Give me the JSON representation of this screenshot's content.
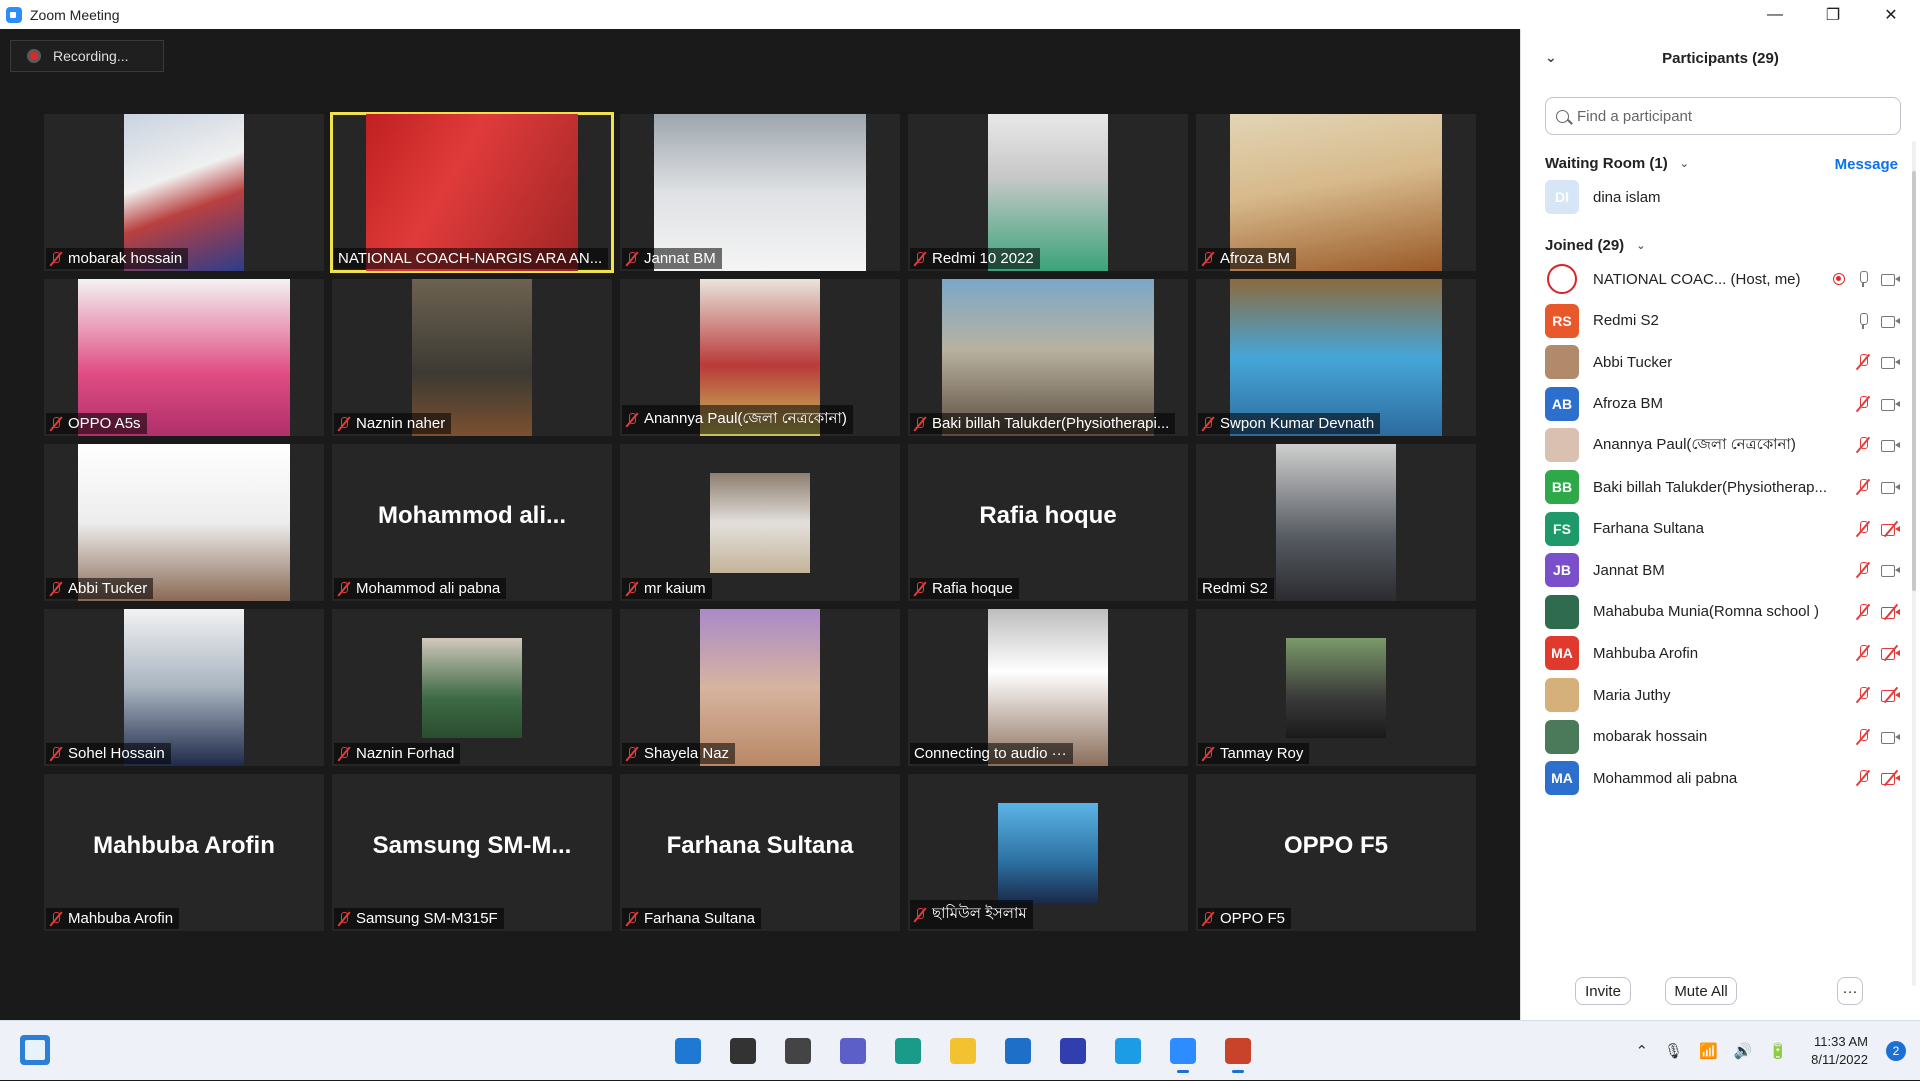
{
  "window": {
    "title": "Zoom Meeting",
    "minimize": "—",
    "restore": "❐",
    "close": "✕"
  },
  "recording": {
    "label": "Recording..."
  },
  "tiles": [
    {
      "label": "mobarak hossain",
      "muted": true,
      "video": "w-narrow",
      "bg": "bg1"
    },
    {
      "label": "NATIONAL COACH-NARGIS ARA AN...",
      "muted": false,
      "video": "w-wide",
      "bg": "bg2",
      "active": true
    },
    {
      "label": "Jannat BM",
      "muted": true,
      "video": "w-wide",
      "bg": "bg3"
    },
    {
      "label": "Redmi 10 2022",
      "muted": true,
      "video": "w-narrow",
      "bg": "bg4"
    },
    {
      "label": "Afroza BM",
      "muted": true,
      "video": "w-wide",
      "bg": "bg5"
    },
    {
      "label": "OPPO A5s",
      "muted": true,
      "video": "w-wide",
      "bg": "bg6"
    },
    {
      "label": "Naznin naher",
      "muted": true,
      "video": "w-narrow",
      "bg": "bg7"
    },
    {
      "label": "Anannya Paul(জেলা নেত্রকোনা)",
      "muted": true,
      "video": "w-narrow",
      "bg": "bg8"
    },
    {
      "label": "Baki billah Talukder(Physiotherapi...",
      "muted": true,
      "video": "w-wide",
      "bg": "bg9"
    },
    {
      "label": "Swpon Kumar Devnath",
      "muted": true,
      "video": "w-wide",
      "bg": "bg10"
    },
    {
      "label": "Abbi Tucker",
      "muted": true,
      "video": "w-wide",
      "bg": "bg11"
    },
    {
      "label": "Mohammod ali pabna",
      "muted": true,
      "bigName": "Mohammod  ali..."
    },
    {
      "label": "mr kaium",
      "muted": true,
      "video": "w-small",
      "bg": "bg12"
    },
    {
      "label": "Rafia hoque",
      "muted": true,
      "bigName": "Rafia hoque"
    },
    {
      "label": "Redmi S2",
      "muted": false,
      "video": "w-narrow",
      "bg": "bg13"
    },
    {
      "label": "Sohel Hossain",
      "muted": true,
      "video": "w-narrow",
      "bg": "bg14"
    },
    {
      "label": "Naznin Forhad",
      "muted": true,
      "video": "w-small",
      "bg": "bg15"
    },
    {
      "label": "Shayela Naz",
      "muted": true,
      "video": "w-narrow",
      "bg": "bg16"
    },
    {
      "label": "Connecting to audio ···",
      "muted": false,
      "video": "w-narrow",
      "bg": "bg17"
    },
    {
      "label": "Tanmay Roy",
      "muted": true,
      "video": "w-small",
      "bg": "bg18"
    },
    {
      "label": "Mahbuba Arofin",
      "muted": true,
      "bigName": "Mahbuba Arofin"
    },
    {
      "label": "Samsung SM-M315F",
      "muted": true,
      "bigName": "Samsung  SM-M..."
    },
    {
      "label": "Farhana Sultana",
      "muted": true,
      "bigName": "Farhana Sultana"
    },
    {
      "label": "ছামিউল ইসলাম",
      "muted": true,
      "video": "w-small",
      "bg": "bg19"
    },
    {
      "label": "OPPO F5",
      "muted": true,
      "bigName": "OPPO F5"
    }
  ],
  "panel": {
    "title": "Participants (29)",
    "collapse_icon": "⌄",
    "search_placeholder": "Find a participant",
    "waiting_room_title": "Waiting Room (1)",
    "message_label": "Message",
    "joined_title": "Joined (29)",
    "chevron": "⌄",
    "waiting": [
      {
        "initials": "DI",
        "name": "dina islam",
        "color": "#d6e6f7"
      }
    ],
    "joined": [
      {
        "initials": "",
        "name": "NATIONAL COAC...  (Host, me)",
        "color": "#ffffff",
        "rec": true,
        "mic": "on",
        "cam": "on",
        "logo": true
      },
      {
        "initials": "RS",
        "name": "Redmi S2",
        "color": "#e8582b",
        "mic": "on",
        "cam": "on"
      },
      {
        "initials": "",
        "name": "Abbi Tucker",
        "color": "#b08a6a",
        "mic": "off",
        "cam": "on"
      },
      {
        "initials": "AB",
        "name": "Afroza BM",
        "color": "#2d6fcc",
        "mic": "off",
        "cam": "on"
      },
      {
        "initials": "",
        "name": "Anannya Paul(জেলা নেত্রকোনা)",
        "color": "#d9c0b0",
        "mic": "off",
        "cam": "on"
      },
      {
        "initials": "BB",
        "name": "Baki billah Talukder(Physiotherap...",
        "color": "#2fa84a",
        "mic": "off",
        "cam": "on"
      },
      {
        "initials": "FS",
        "name": "Farhana Sultana",
        "color": "#1e9a6a",
        "mic": "off",
        "cam": "off"
      },
      {
        "initials": "JB",
        "name": "Jannat BM",
        "color": "#7a4fc9",
        "mic": "off",
        "cam": "on"
      },
      {
        "initials": "",
        "name": "Mahabuba Munia(Romna school )",
        "color": "#2f6b4e",
        "mic": "off",
        "cam": "off"
      },
      {
        "initials": "MA",
        "name": "Mahbuba Arofin",
        "color": "#e0392e",
        "mic": "off",
        "cam": "off"
      },
      {
        "initials": "",
        "name": "Maria Juthy",
        "color": "#d5b07a",
        "mic": "off",
        "cam": "off"
      },
      {
        "initials": "",
        "name": "mobarak hossain",
        "color": "#4b7a5a",
        "mic": "off",
        "cam": "on"
      },
      {
        "initials": "MA",
        "name": "Mohammod ali pabna",
        "color": "#2d6fcc",
        "mic": "off",
        "cam": "off"
      }
    ],
    "invite_label": "Invite",
    "mute_all_label": "Mute All",
    "more_label": "···"
  },
  "taskbar": {
    "time": "11:33 AM",
    "date": "8/11/2022",
    "notifications": "2",
    "apps": [
      {
        "name": "start-button",
        "color": "#1f78d1"
      },
      {
        "name": "search-app",
        "color": "#333333"
      },
      {
        "name": "task-view-app",
        "color": "#444444"
      },
      {
        "name": "chat-app",
        "color": "#5b5fc7"
      },
      {
        "name": "edge-browser-app",
        "color": "#1a9b8a"
      },
      {
        "name": "file-explorer-app",
        "color": "#f2c230"
      },
      {
        "name": "mail-app",
        "color": "#1e6fc7"
      },
      {
        "name": "whiteboard-app",
        "color": "#2f3fb0"
      },
      {
        "name": "skype-app",
        "color": "#1b9ce5"
      },
      {
        "name": "zoom-app",
        "color": "#2d8cff",
        "active": true
      },
      {
        "name": "powerpoint-app",
        "color": "#c8432a",
        "active": true
      }
    ],
    "tray": [
      "⌃",
      "🎙",
      "📶",
      "🔊",
      "🔋"
    ]
  }
}
